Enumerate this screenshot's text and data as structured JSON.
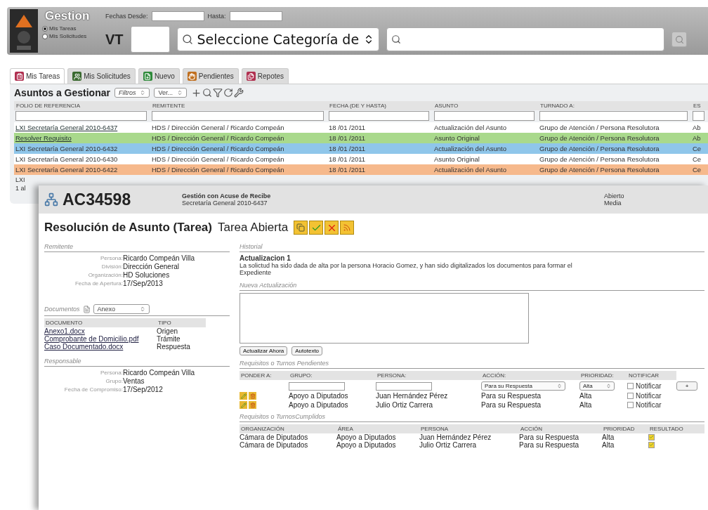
{
  "header": {
    "title": "Gestion",
    "date_from_label": "Fechas Desde:",
    "date_to_label": "Hasta:",
    "view_options": [
      {
        "label": "Mis Tareas",
        "selected": true
      },
      {
        "label": "Mis Solicitudes",
        "selected": false
      }
    ],
    "vt_label": "VT",
    "category_select": "Seleccione Categoría de"
  },
  "tabs": [
    {
      "label": "Mis Tareas",
      "selected": true,
      "color": "#b03050"
    },
    {
      "label": "Mis Solicitudes",
      "selected": false,
      "color": "#3a6a30"
    },
    {
      "label": "Nuevo",
      "selected": false,
      "color": "#2e8a3a"
    },
    {
      "label": "Pendientes",
      "selected": false,
      "color": "#c07020"
    },
    {
      "label": "Repotes",
      "selected": false,
      "color": "#b03050"
    }
  ],
  "list": {
    "title": "Asuntos a Gestionar",
    "filters_select": "Filtros",
    "view_select": "Ver...",
    "columns": [
      "FOLIO DE REFERENCIA",
      "REMITENTE",
      "FECHA (DE Y HASTA)",
      "ASUNTO",
      "TURNADO A:",
      "ES"
    ],
    "rows": [
      {
        "color": "#ffffff",
        "link": true,
        "cells": [
          "LXI Secretaría General 2010-6437",
          "HDS / Dirección General / Ricardo Compeán",
          "18 /01 /2011",
          "Actualización del Asunto",
          "Grupo de Atención / Persona Resolutora",
          "Ab"
        ]
      },
      {
        "color": "#a9d98c",
        "link": true,
        "cells": [
          "Resolver Requisito",
          "HDS / Dirección General / Ricardo Compeán",
          "18 /01 /2011",
          "Asunto Original",
          "Grupo de Atención / Persona Resolutora",
          "Ab"
        ]
      },
      {
        "color": "#8fc6ea",
        "link": false,
        "cells": [
          "LXI Secretaría General 2010-6432",
          "HDS / Dirección General / Ricardo Compeán",
          "18 /01 /2011",
          "Actualización del Asunto",
          "Grupo de Atención / Persona Resolutora",
          "Ce"
        ]
      },
      {
        "color": "#ffffff",
        "link": false,
        "cells": [
          "LXI Secretaría General 2010-6430",
          "HDS / Dirección General / Ricardo Compeán",
          "18 /01 /2011",
          "Asunto Original",
          "Grupo de Atención / Persona Resolutora",
          "Ce"
        ]
      },
      {
        "color": "#f6b98c",
        "link": false,
        "cells": [
          "LXI Secretaría General 2010-6422",
          "HDS / Dirección General / Ricardo Compeán",
          "18 /01 /2011",
          "Actualización del Asunto",
          "Grupo de Atención / Persona Resolutora",
          "Ce"
        ]
      }
    ],
    "cut_row": "LXI",
    "pager": "1 al"
  },
  "dialog": {
    "code": "AC34598",
    "subject": "Gestión con Acuse de Recibe",
    "folio": "Secretaría General 2010-6437",
    "status": "Abierto",
    "priority": "Media",
    "title": "Resolución de Asunto (Tarea)",
    "state": "Tarea Abierta",
    "remitente": {
      "heading": "Remitente",
      "fields": [
        {
          "label": "Persona:",
          "value": "Ricardo Compeán Villa"
        },
        {
          "label": "División:",
          "value": "Dirección General"
        },
        {
          "label": "Organización:",
          "value": "HD Soluciones"
        },
        {
          "label": "Fecha de Apertura:",
          "value": "17/Sep/2013"
        }
      ]
    },
    "documents": {
      "heading": "Documentos",
      "type_select": "Anexo",
      "columns": [
        "DOCUMENTO",
        "TIPO"
      ],
      "rows": [
        {
          "name": "Anexo1.docx",
          "type": "Origen"
        },
        {
          "name": "Comprobante de Domicilio.pdf",
          "type": "Trámite"
        },
        {
          "name": "Caso Documentado.docx",
          "type": "Respuesta"
        }
      ]
    },
    "responsable": {
      "heading": "Responsable",
      "fields": [
        {
          "label": "Persona:",
          "value": "Ricardo Compeán Villa"
        },
        {
          "label": "Grupo:",
          "value": "Ventas"
        },
        {
          "label": "Fecha de Compromiso:",
          "value": "17/Sep/2012"
        }
      ]
    },
    "history": {
      "heading": "Historial",
      "entry_title": "Actualizacion 1",
      "entry_text": "La solictud ha sido dada de alta por la persona Horacio Gomez, y han sido digitalizados los documentos para formar el Expediente"
    },
    "update": {
      "heading": "Nueva Actualización",
      "buttons": [
        "Actualizar Ahora",
        "Autotexto"
      ]
    },
    "pending": {
      "heading": "Requisitos o Turnos Pendientes",
      "columns": [
        "PONDER A:",
        "GRUPO:",
        "PERSONA:",
        "ACCIÓN:",
        "PRIORIDAD:",
        "NOTIFICAR"
      ],
      "new_row": {
        "action": "Para su Respuesta",
        "priority": "Alta",
        "notify_label": "Notificar",
        "notify": false,
        "add_button": "+"
      },
      "rows": [
        {
          "group": "Apoyo a Diputados",
          "person": "Juan Hernández Pérez",
          "action": "Para su Respuesta",
          "priority": "Alta",
          "notify_label": "Notificar",
          "notify": false
        },
        {
          "group": "Apoyo a Diputados",
          "person": "Julio Ortiz Carrera",
          "action": "Para su Respuesta",
          "priority": "Alta",
          "notify_label": "Notificar",
          "notify": false
        }
      ]
    },
    "done": {
      "heading": "Requisitos o TurnosCumplidos",
      "columns": [
        "ORGANIZACIÓN",
        "ÁREA",
        "PERSONA",
        "ACCIÓN",
        "PRIORIDAD",
        "RESULTADO"
      ],
      "rows": [
        {
          "cells": [
            "Cámara de Diputados",
            "Apoyo a Diputados",
            "Juan Hernández Pérez",
            "Para su Respuesta",
            "Alta"
          ],
          "checked": true
        },
        {
          "cells": [
            "Cámara de Diputados",
            "Apoyo a Diputados",
            "Julio Ortiz Carrera",
            "Para su Respuesta",
            "Alta"
          ],
          "checked": true
        }
      ]
    }
  }
}
